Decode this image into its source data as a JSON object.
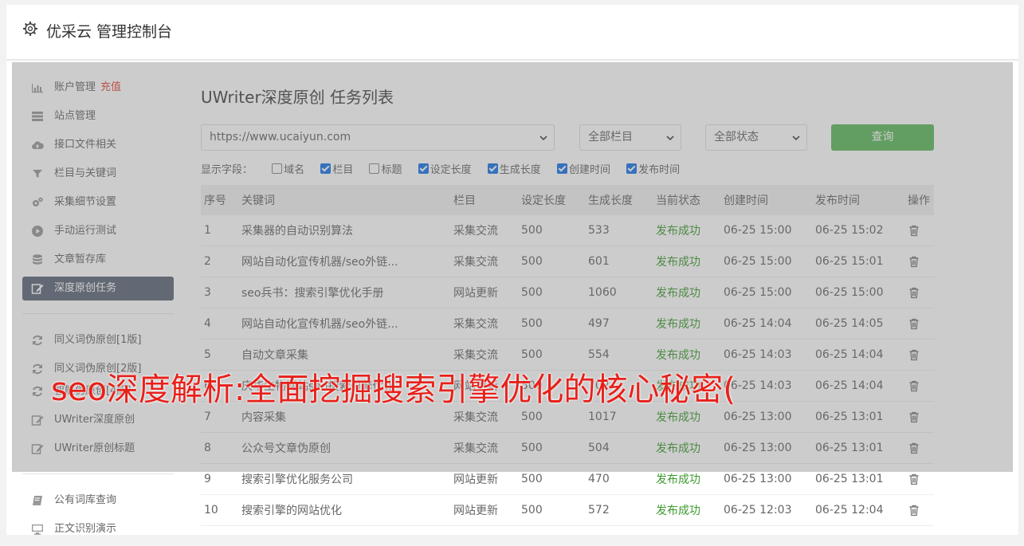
{
  "header": {
    "title": "优采云 管理控制台"
  },
  "sidebar": {
    "group1": [
      {
        "label": "账户管理",
        "badge": "充值",
        "icon": "bar-chart-icon"
      },
      {
        "label": "站点管理",
        "icon": "server-icon"
      },
      {
        "label": "接口文件相关",
        "icon": "cloud-upload-icon"
      },
      {
        "label": "栏目与关键词",
        "icon": "filter-icon"
      },
      {
        "label": "采集细节设置",
        "icon": "gears-icon"
      },
      {
        "label": "手动运行测试",
        "icon": "play-circle-icon"
      },
      {
        "label": "文章暂存库",
        "icon": "database-icon"
      },
      {
        "label": "深度原创任务",
        "icon": "edit-icon",
        "active": true
      }
    ],
    "group2": [
      {
        "label": "同义词伪原创[1版]",
        "icon": "refresh-icon"
      },
      {
        "label": "同义词伪原创[2版]",
        "icon": "refresh-icon"
      },
      {
        "label": "智能伪原创[4版]",
        "icon": "refresh-icon"
      },
      {
        "label": "UWriter深度原创",
        "icon": "edit-icon"
      },
      {
        "label": "UWriter原创标题",
        "icon": "edit-icon"
      }
    ],
    "group3": [
      {
        "label": "公有词库查询",
        "icon": "book-icon"
      },
      {
        "label": "正文识别演示",
        "icon": "monitor-icon"
      }
    ]
  },
  "main": {
    "title": "UWriter深度原创 任务列表",
    "site_select": "https://www.ucaiyun.com",
    "column_select": "全部栏目",
    "status_select": "全部状态",
    "query_label": "查询",
    "fields_label": "显示字段：",
    "fields": [
      {
        "label": "域名",
        "checked": false
      },
      {
        "label": "栏目",
        "checked": true
      },
      {
        "label": "标题",
        "checked": false
      },
      {
        "label": "设定长度",
        "checked": true
      },
      {
        "label": "生成长度",
        "checked": true
      },
      {
        "label": "创建时间",
        "checked": true
      },
      {
        "label": "发布时间",
        "checked": true
      }
    ]
  },
  "table": {
    "headers": [
      "序号",
      "关键词",
      "栏目",
      "设定长度",
      "生成长度",
      "当前状态",
      "创建时间",
      "发布时间",
      "操作"
    ],
    "rows": [
      [
        "1",
        "采集器的自动识别算法",
        "采集交流",
        "500",
        "533",
        "发布成功",
        "06-25 15:00",
        "06-25 15:02"
      ],
      [
        "2",
        "网站自动化宣传机器/seo外链...",
        "采集交流",
        "500",
        "601",
        "发布成功",
        "06-25 15:00",
        "06-25 15:01"
      ],
      [
        "3",
        "seo兵书：搜索引擎优化手册",
        "网站更新",
        "500",
        "1060",
        "发布成功",
        "06-25 15:00",
        "06-25 15:00"
      ],
      [
        "4",
        "网站自动化宣传机器/seo外链...",
        "采集交流",
        "500",
        "497",
        "发布成功",
        "06-25 14:04",
        "06-25 14:05"
      ],
      [
        "5",
        "自动文章采集",
        "采集交流",
        "500",
        "554",
        "发布成功",
        "06-25 14:03",
        "06-25 14:04"
      ],
      [
        "6",
        "庆华生物网站seo搜索引擎优化",
        "网站更新",
        "500",
        "702",
        "发布成功",
        "06-25 14:03",
        "06-25 14:04"
      ],
      [
        "7",
        "内容采集",
        "采集交流",
        "500",
        "1017",
        "发布成功",
        "06-25 13:00",
        "06-25 13:01"
      ],
      [
        "8",
        "公众号文章伪原创",
        "采集交流",
        "500",
        "504",
        "发布成功",
        "06-25 13:00",
        "06-25 13:01"
      ],
      [
        "9",
        "搜索引擎优化服务公司",
        "网站更新",
        "500",
        "470",
        "发布成功",
        "06-25 13:00",
        "06-25 13:01"
      ],
      [
        "10",
        "搜索引擎的网站优化",
        "网站更新",
        "500",
        "572",
        "发布成功",
        "06-25 12:03",
        "06-25 12:04"
      ]
    ]
  },
  "overlay_text": "seo深度解析:全面挖掘搜索引擎优化的核心秘密(",
  "colors": {
    "success": "#3d9a2e",
    "accent_red": "#e0483a",
    "query_green": "#5cb85c",
    "active_nav": "#5e6878",
    "banner_red": "#e8201a"
  }
}
